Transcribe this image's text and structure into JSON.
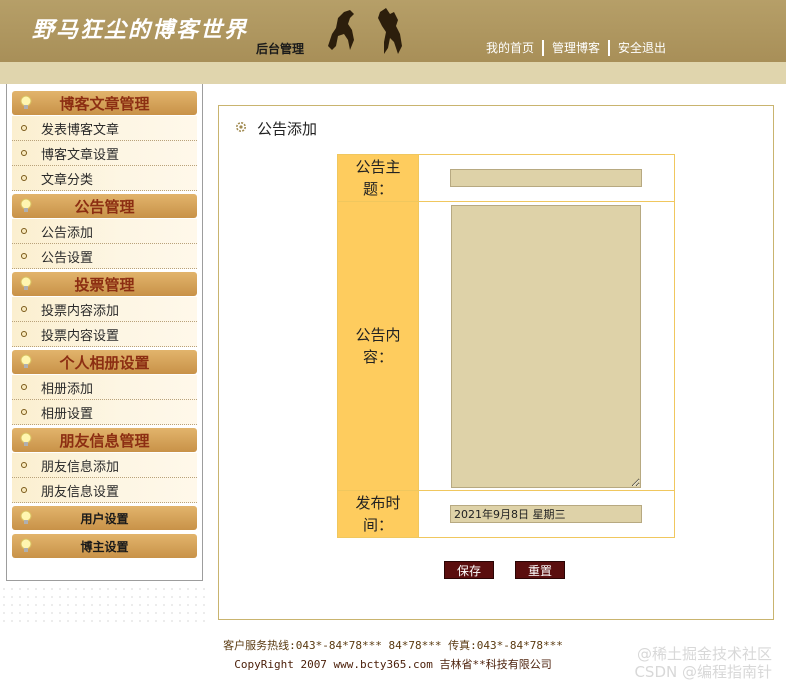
{
  "header": {
    "logo_text": "野马狂尘的博客世界",
    "subtitle": "后台管理",
    "nav": [
      {
        "label": "我的首页"
      },
      {
        "label": "管理博客"
      },
      {
        "label": "安全退出"
      }
    ]
  },
  "sidebar": {
    "sections": [
      {
        "title": "博客文章管理",
        "items": [
          "发表博客文章",
          "博客文章设置",
          "文章分类"
        ]
      },
      {
        "title": "公告管理",
        "items": [
          "公告添加",
          "公告设置"
        ]
      },
      {
        "title": "投票管理",
        "items": [
          "投票内容添加",
          "投票内容设置"
        ]
      },
      {
        "title": "个人相册设置",
        "items": [
          "相册添加",
          "相册设置"
        ]
      },
      {
        "title": "朋友信息管理",
        "items": [
          "朋友信息添加",
          "朋友信息设置"
        ]
      },
      {
        "title": "用户设置",
        "items": []
      },
      {
        "title": "博主设置",
        "items": []
      }
    ]
  },
  "main": {
    "page_title": "公告添加",
    "form": {
      "subject_label_1": "公告主",
      "subject_label_2": "题：",
      "subject_value": "",
      "content_label_1": "公告内",
      "content_label_2": "容：",
      "content_value": "",
      "time_label_1": "发布时",
      "time_label_2": "间：",
      "time_value": "2021年9月8日 星期三"
    },
    "buttons": {
      "save": "保存",
      "reset": "重置"
    }
  },
  "footer": {
    "line1": "客户服务热线:043*-84*78*** 84*78*** 传真:043*-84*78***",
    "line2": "CopyRight 2007 www.bcty365.com 吉林省**科技有限公司"
  },
  "watermark": {
    "line1": "@稀土掘金技术社区",
    "line2": "CSDN @编程指南针"
  },
  "colors": {
    "header": "#ad9560",
    "band": "#e0d5ad",
    "section_header": "#d7a55d",
    "label_bg": "#fecc5e",
    "input_bg": "#ded2a8",
    "button_bg": "#5a0e0e"
  }
}
